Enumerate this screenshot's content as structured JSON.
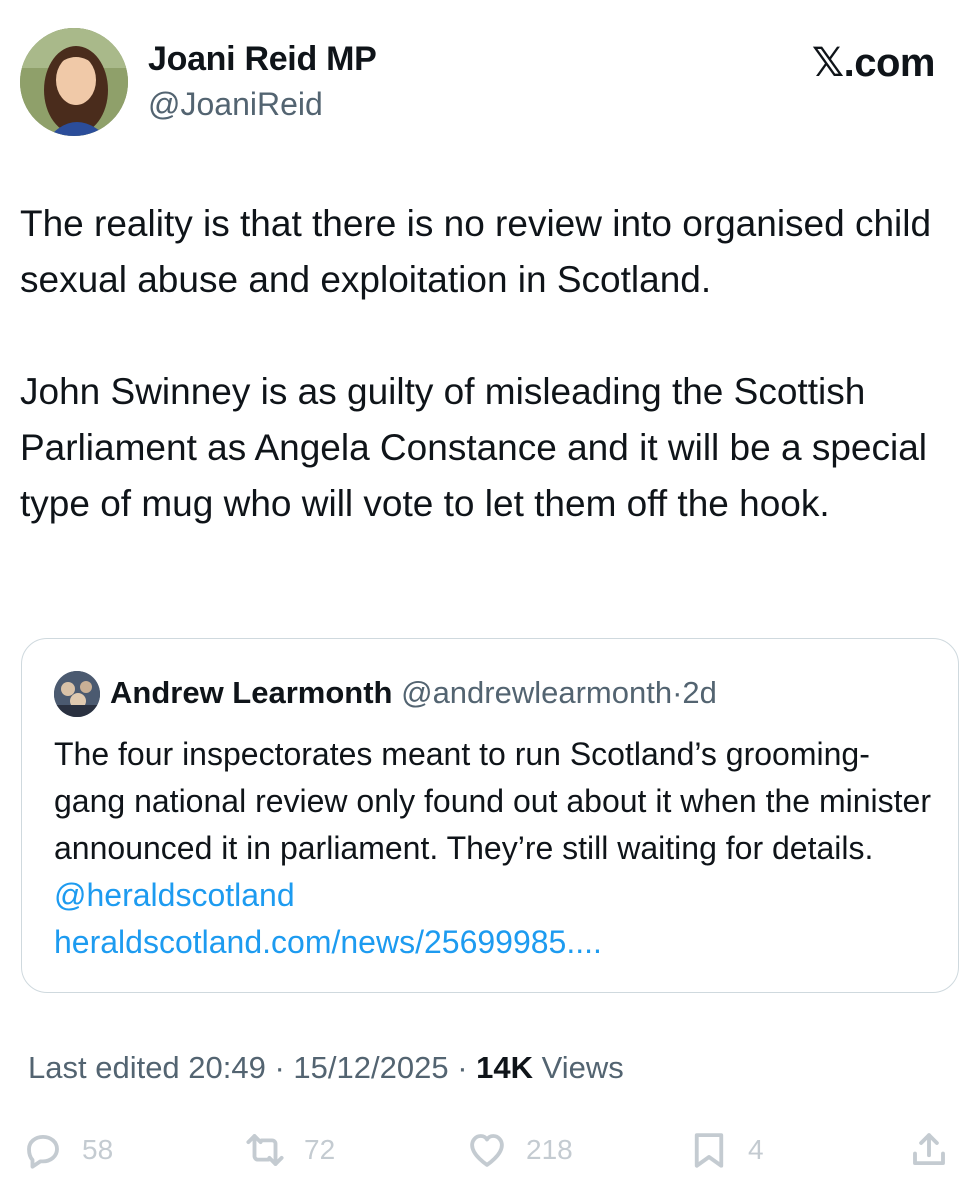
{
  "brand": "𝕏.com",
  "author": {
    "name": "Joani Reid MP",
    "handle": "@JoaniReid"
  },
  "tweet": {
    "paragraphs": [
      "The reality is that there is no review into organised child sexual abuse and exploitation in Scotland.",
      "John Swinney is as guilty of misleading the Scottish Parliament as Angela Constance and it will be a special type of mug who will vote to let them off the hook."
    ]
  },
  "quote": {
    "name": "Andrew Learmonth",
    "handle": "@andrewlearmonth",
    "separator": "·",
    "time": "2d",
    "text": "The four inspectorates meant to run Scotland’s grooming-gang national review only found out about it when the minister announced it in parliament. They’re still waiting for details.",
    "mention": "@heraldscotland",
    "link": "heraldscotland.com/news/25699985...."
  },
  "meta": {
    "edited": "Last edited 20:49 · 15/12/2025",
    "separator": "·",
    "views_count": "14K",
    "views_label": "Views"
  },
  "actions": {
    "replies": "58",
    "reposts": "72",
    "likes": "218",
    "bookmarks": "4"
  },
  "icons": {
    "reply": "reply-icon",
    "repost": "repost-icon",
    "like": "heart-icon",
    "bookmark": "bookmark-icon",
    "share": "share-icon"
  },
  "colors": {
    "text": "#0f1419",
    "secondary": "#536471",
    "link": "#1d9bf0",
    "border": "#cfd9de",
    "icons": "#c4cbd1"
  }
}
